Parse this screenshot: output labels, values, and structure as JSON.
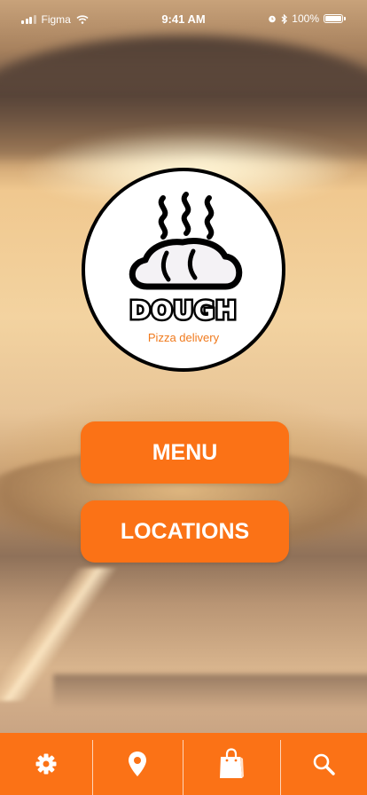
{
  "status_bar": {
    "carrier": "Figma",
    "time": "9:41 AM",
    "battery": "100%"
  },
  "logo": {
    "brand": "DOUGH",
    "tagline": "Pizza delivery"
  },
  "buttons": {
    "menu": "MENU",
    "locations": "LOCATIONS"
  },
  "tab_bar": {
    "items": [
      {
        "icon": "gear-icon"
      },
      {
        "icon": "map-pin-icon"
      },
      {
        "icon": "shopping-bag-icon"
      },
      {
        "icon": "search-icon"
      }
    ]
  },
  "colors": {
    "accent": "#fb7216",
    "tagline": "#f07a1d"
  }
}
